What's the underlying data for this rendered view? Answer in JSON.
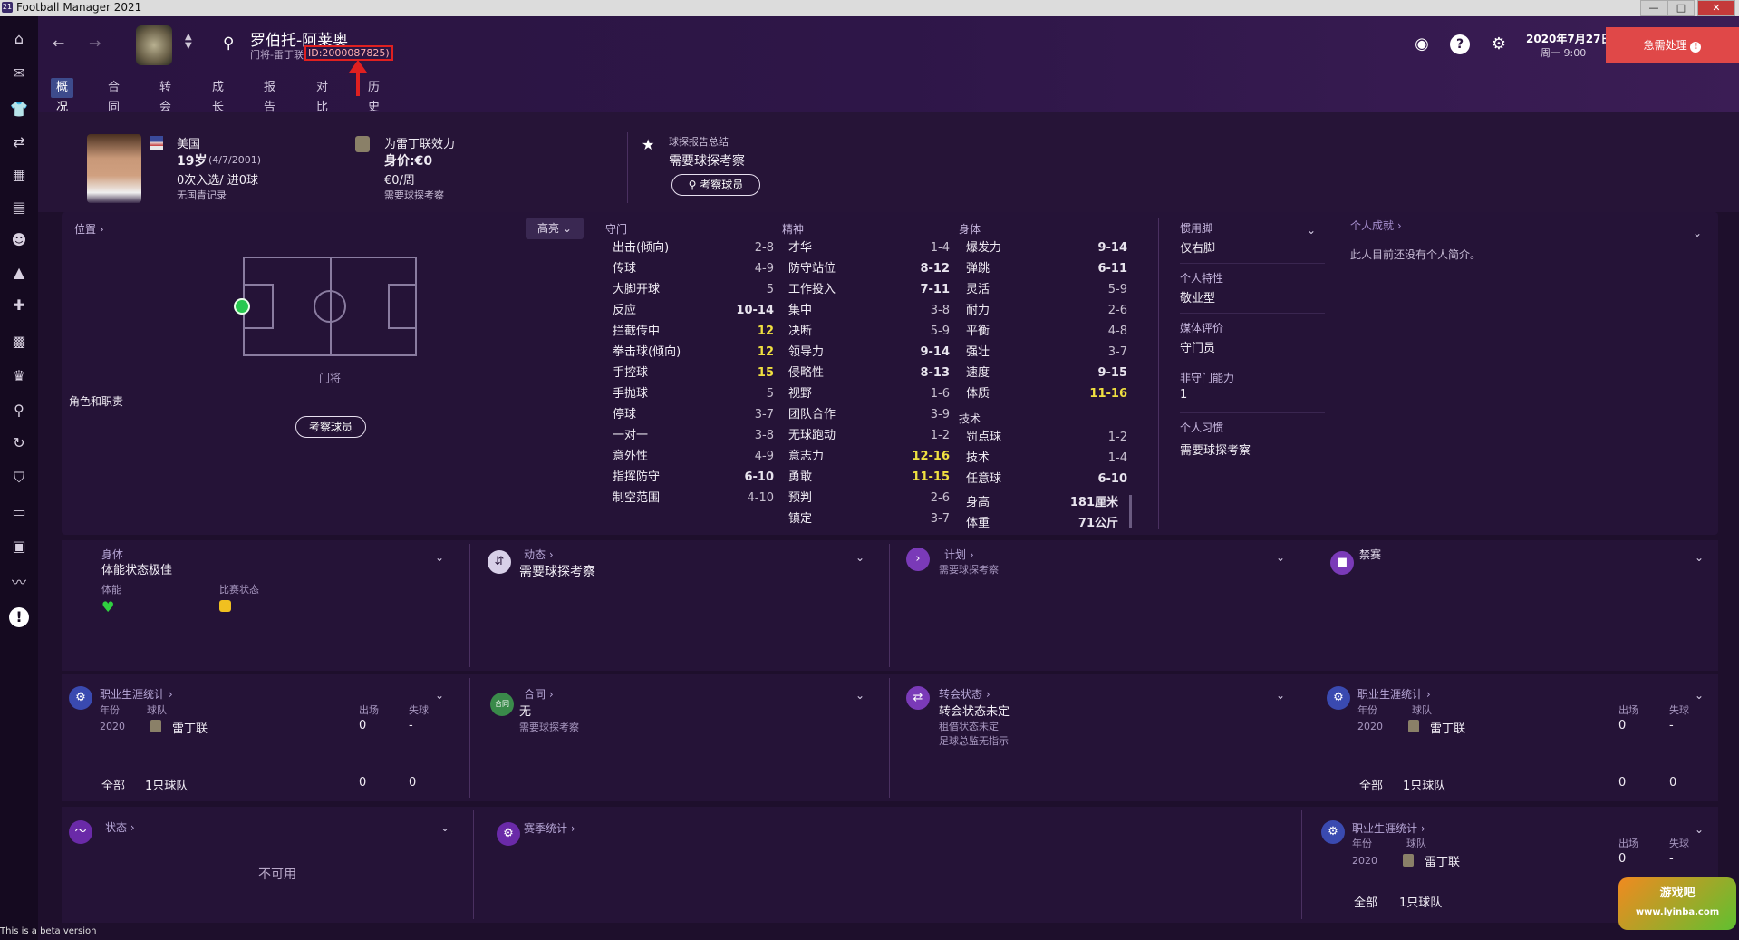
{
  "app": {
    "window_title": "Football Manager 2021",
    "beta_text": "This is a beta version"
  },
  "window_controls": {
    "minimize": "—",
    "maximize": "□",
    "close": "✕"
  },
  "player": {
    "name": "罗伯托-阿莱奥",
    "subtitle": "门将-雷丁联",
    "id_text": "ID:2000087825)",
    "nationality": "美国",
    "age": "19岁",
    "dob": "(4/7/2001)",
    "caps": "0次入选/ 进0球",
    "youth": "无国青记录",
    "club_line": "为雷丁联效力",
    "value": "身价:€0",
    "wage": "€0/周",
    "scout_needed": "需要球探考察"
  },
  "scout_report": {
    "title": "球探报告总结",
    "text": "需要球探考察",
    "button": "考察球员"
  },
  "topbar": {
    "date_line1": "2020年7月27日",
    "date_line2": "周一 9:00",
    "urgent_label": "急需处理"
  },
  "tabs": [
    {
      "label": "概况"
    },
    {
      "label": "合同"
    },
    {
      "label": "转会"
    },
    {
      "label": "成长"
    },
    {
      "label": "报告"
    },
    {
      "label": "对比"
    },
    {
      "label": "历史"
    }
  ],
  "position": {
    "title": "位置",
    "pos_label": "门将",
    "roles_label": "角色和职责",
    "scout_button": "考察球员",
    "highlight_label": "高亮"
  },
  "goalkeeping": {
    "title": "守门",
    "rows": [
      {
        "name": "出击(倾向)",
        "value": "2-8",
        "style": "mid"
      },
      {
        "name": "传球",
        "value": "4-9",
        "style": "mid"
      },
      {
        "name": "大脚开球",
        "value": "5",
        "style": "mid"
      },
      {
        "name": "反应",
        "value": "10-14",
        "style": "b"
      },
      {
        "name": "拦截传中",
        "value": "12",
        "style": "hi"
      },
      {
        "name": "拳击球(倾向)",
        "value": "12",
        "style": "hi"
      },
      {
        "name": "手控球",
        "value": "15",
        "style": "hi"
      },
      {
        "name": "手抛球",
        "value": "5",
        "style": "mid"
      },
      {
        "name": "停球",
        "value": "3-7",
        "style": "mid"
      },
      {
        "name": "一对一",
        "value": "3-8",
        "style": "mid"
      },
      {
        "name": "意外性",
        "value": "4-9",
        "style": "mid"
      },
      {
        "name": "指挥防守",
        "value": "6-10",
        "style": "b"
      },
      {
        "name": "制空范围",
        "value": "4-10",
        "style": "mid"
      }
    ]
  },
  "mental": {
    "title": "精神",
    "rows": [
      {
        "name": "才华",
        "value": "1-4",
        "style": "mid"
      },
      {
        "name": "防守站位",
        "value": "8-12",
        "style": "b"
      },
      {
        "name": "工作投入",
        "value": "7-11",
        "style": "b"
      },
      {
        "name": "集中",
        "value": "3-8",
        "style": "mid"
      },
      {
        "name": "决断",
        "value": "5-9",
        "style": "mid"
      },
      {
        "name": "领导力",
        "value": "9-14",
        "style": "b"
      },
      {
        "name": "侵略性",
        "value": "8-13",
        "style": "b"
      },
      {
        "name": "视野",
        "value": "1-6",
        "style": "mid"
      },
      {
        "name": "团队合作",
        "value": "3-9",
        "style": "mid"
      },
      {
        "name": "无球跑动",
        "value": "1-2",
        "style": "mid"
      },
      {
        "name": "意志力",
        "value": "12-16",
        "style": "hi"
      },
      {
        "name": "勇敢",
        "value": "11-15",
        "style": "hi"
      },
      {
        "name": "预判",
        "value": "2-6",
        "style": "mid"
      },
      {
        "name": "镇定",
        "value": "3-7",
        "style": "mid"
      }
    ]
  },
  "physical": {
    "title": "身体",
    "rows": [
      {
        "name": "爆发力",
        "value": "9-14",
        "style": "b"
      },
      {
        "name": "弹跳",
        "value": "6-11",
        "style": "b"
      },
      {
        "name": "灵活",
        "value": "5-9",
        "style": "mid"
      },
      {
        "name": "耐力",
        "value": "2-6",
        "style": "mid"
      },
      {
        "name": "平衡",
        "value": "4-8",
        "style": "mid"
      },
      {
        "name": "强壮",
        "value": "3-7",
        "style": "mid"
      },
      {
        "name": "速度",
        "value": "9-15",
        "style": "b"
      },
      {
        "name": "体质",
        "value": "11-16",
        "style": "hi"
      }
    ],
    "tech_title": "技术",
    "tech_rows": [
      {
        "name": "罚点球",
        "value": "1-2",
        "style": "mid"
      },
      {
        "name": "技术",
        "value": "1-4",
        "style": "mid"
      },
      {
        "name": "任意球",
        "value": "6-10",
        "style": "b"
      }
    ],
    "height_label": "身高",
    "height_value": "181厘米",
    "weight_label": "体重",
    "weight_value": "71公斤"
  },
  "info": {
    "foot_label": "惯用脚",
    "foot_value": "仅右脚",
    "trait_label": "个人特性",
    "trait_value": "敬业型",
    "media_label": "媒体评价",
    "media_value": "守门员",
    "nongk_label": "非守门能力",
    "nongk_value": "1",
    "habit_label": "个人习惯",
    "habit_value": "需要球探考察"
  },
  "achievements": {
    "title": "个人成就",
    "text": "此人目前还没有个人简介。"
  },
  "cards": {
    "body": {
      "title": "身体",
      "main": "体能状态极佳",
      "fitness_label": "体能",
      "match_label": "比赛状态"
    },
    "dynamics": {
      "title": "动态",
      "main": "需要球探考察"
    },
    "plan": {
      "title": "计划",
      "sub": "需要球探考察"
    },
    "ban": {
      "title": "禁赛"
    },
    "career1": {
      "title": "职业生涯统计",
      "col_year": "年份",
      "col_team": "球队",
      "col_apps": "出场",
      "col_goals": "失球",
      "year": "2020",
      "team": "雷丁联",
      "apps": "0",
      "goals": "-",
      "total_label": "全部",
      "total_team": "1只球队",
      "total_apps": "0",
      "total_goals": "0"
    },
    "contract": {
      "title": "合同",
      "main": "无",
      "sub": "需要球探考察",
      "icon_text": "合同"
    },
    "transfer": {
      "title": "转会状态",
      "main": "转会状态未定",
      "sub1": "租借状态未定",
      "sub2": "足球总监无指示"
    },
    "career2": {
      "title": "职业生涯统计",
      "col_year": "年份",
      "col_team": "球队",
      "col_apps": "出场",
      "col_goals": "失球",
      "year": "2020",
      "team": "雷丁联",
      "apps": "0",
      "goals": "-",
      "total_label": "全部",
      "total_team": "1只球队",
      "total_apps": "0",
      "total_goals": "0"
    },
    "form": {
      "title": "状态",
      "main": "不可用"
    },
    "season": {
      "title": "赛季统计"
    },
    "career3": {
      "title": "职业生涯统计",
      "col_year": "年份",
      "col_team": "球队",
      "col_apps": "出场",
      "col_goals": "失球",
      "year": "2020",
      "team": "雷丁联",
      "apps": "0",
      "goals": "-",
      "total_label": "全部",
      "total_team": "1只球队"
    }
  },
  "watermark": {
    "line1": "游戏吧",
    "line2": "www.lyinba.com"
  },
  "colors": {
    "accent_tab": "#3d4b8c",
    "urgent": "#e04848",
    "highlight_value": "#f0e040",
    "bg": "#1e0f2c"
  }
}
